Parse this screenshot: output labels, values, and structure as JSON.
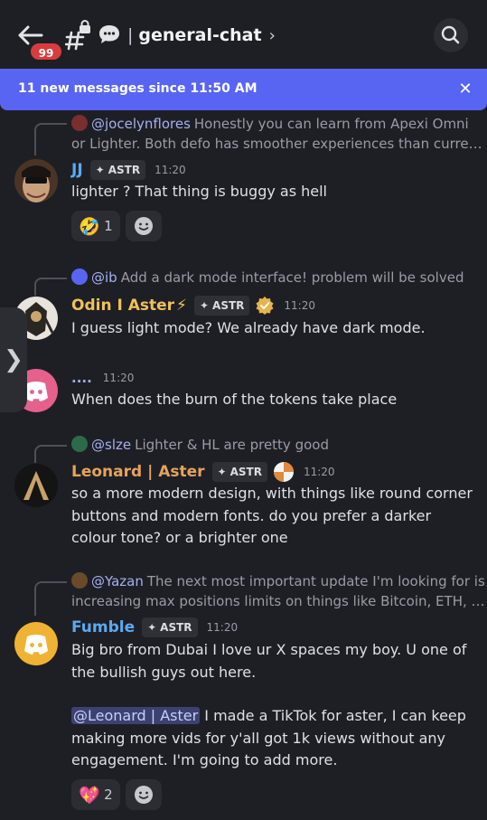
{
  "header": {
    "unread_badge": "99",
    "separator": "|",
    "channel_name": "general-chat",
    "chevron": "›"
  },
  "banner": {
    "text": "11 new messages since 11:50 AM",
    "close": "✕",
    "color": "#5865f2"
  },
  "icons": [
    "back-arrow-icon",
    "hash-lock-icon",
    "chat-bubble-icon",
    "search-icon",
    "close-icon",
    "astr-diamond-icon",
    "verified-icon",
    "lightning-icon",
    "discord-logo-icon",
    "add-reaction-icon"
  ],
  "messages": [
    {
      "reply_name": "@jocelynflores",
      "reply_text": "Honestly you can learn from Apexi Omni",
      "reply_text2": "or Lighter. Both defo has smoother experiences than curre…",
      "user": "JJ",
      "user_color": "#5aaaf0",
      "tag": "ASTR",
      "time": "11:20",
      "text": "lighter ? That thing is buggy as hell",
      "reaction_count": "1",
      "reaction_emoji": "🤣"
    },
    {
      "reply_name": "@ib",
      "reply_text": "Add a dark mode interface! problem will be solved",
      "user": "Odin I Aster",
      "user_emoji": "⚡",
      "user_color": "#f0c05a",
      "tag": "ASTR",
      "time": "11:20",
      "text": "I guess light mode? We already have dark mode."
    },
    {
      "user": "....",
      "user_color": "#a4b0f0",
      "time": "11:20",
      "text": "When does the burn of the tokens take place"
    },
    {
      "reply_name": "@slze",
      "reply_text": "Lighter & HL are pretty good",
      "user": "Leonard | Aster",
      "user_color": "#e6a35a",
      "tag": "ASTR",
      "time": "11:20",
      "text": "so a more modern design, with things like round corner buttons and modern fonts. do you prefer a darker colour tone? or a brighter one"
    },
    {
      "reply_name": "@Yazan",
      "reply_text": "The next most important update I'm looking for is",
      "reply_text2": "increasing max positions limits on things like Bitcoin, ETH, …",
      "user": "Fumble",
      "user_color": "#5aaaf0",
      "tag": "ASTR",
      "time": "11:20",
      "text": "Big bro from Dubai I love ur X spaces my boy. U one of the bullish guys out here.",
      "mention": "@Leonard | Aster",
      "text2": " I made a TikTok for aster, I can keep making more vids for y'all got 1k views without any engagement. I'm going to add more.",
      "reaction_count": "2",
      "reaction_emoji": "💖"
    }
  ],
  "side_tab": "❯"
}
